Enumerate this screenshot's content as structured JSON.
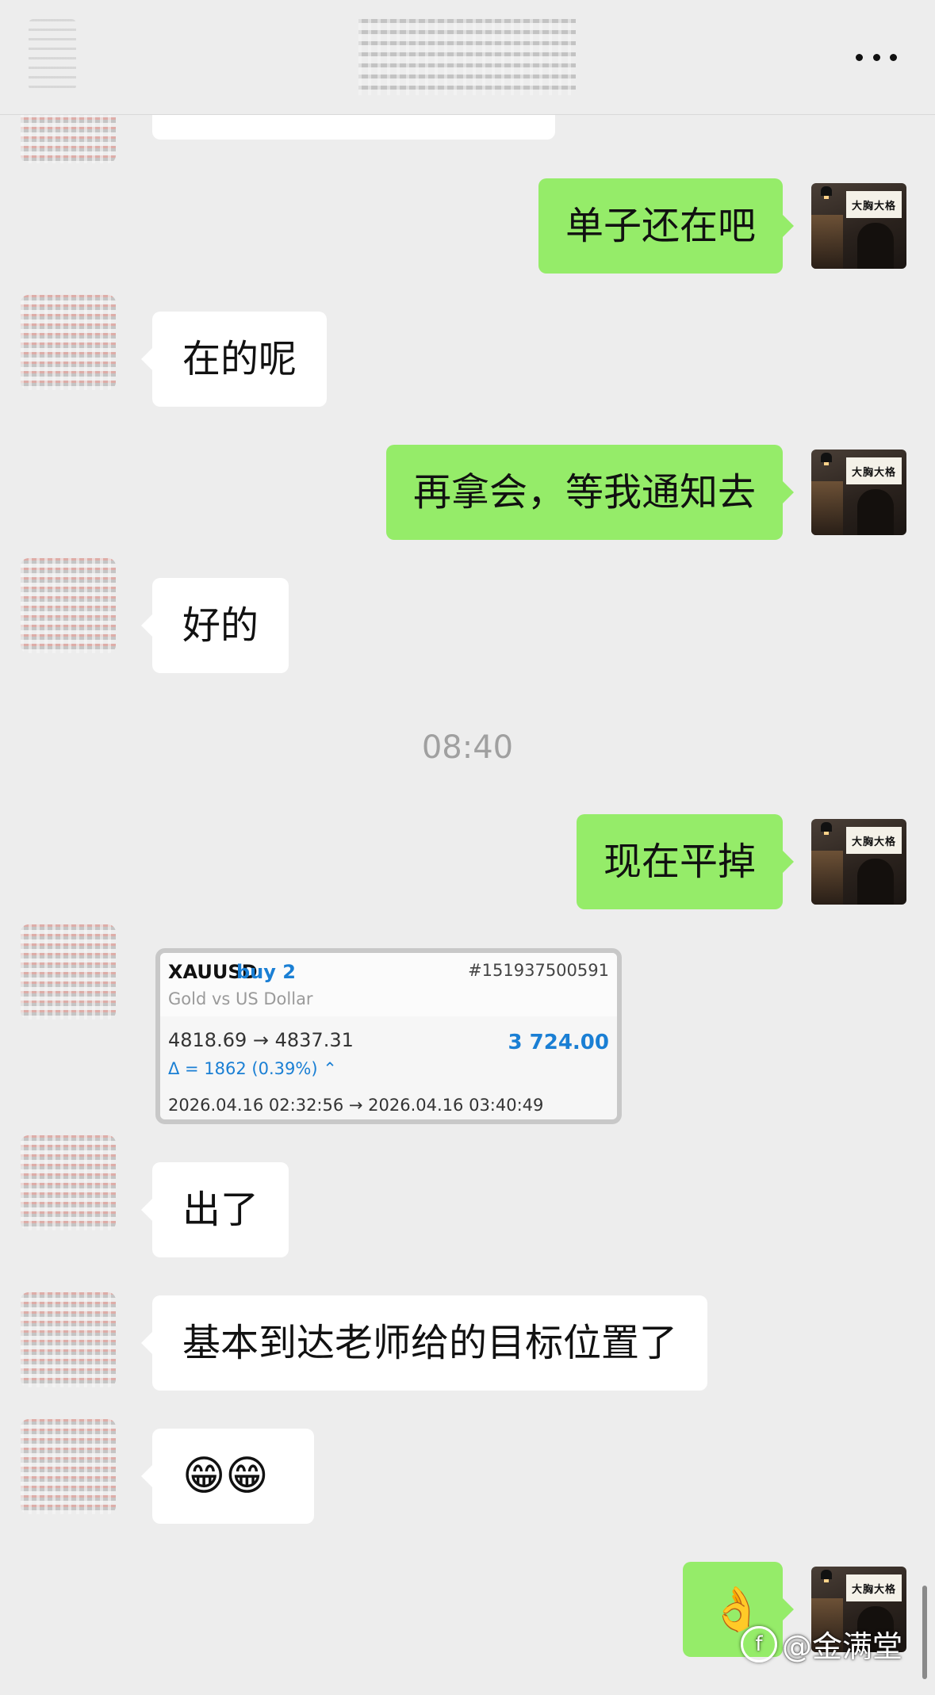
{
  "header": {
    "more_icon": "more-dots-icon"
  },
  "messages": [
    {
      "side": "right",
      "text": "单子还在吧"
    },
    {
      "side": "left",
      "text": "在的呢"
    },
    {
      "side": "right",
      "text": "再拿会，等我通知去"
    },
    {
      "side": "left",
      "text": "好的"
    },
    {
      "side": "right",
      "text": "现在平掉"
    },
    {
      "side": "left",
      "text": "出了"
    },
    {
      "side": "left",
      "text": "基本到达老师给的目标位置了"
    },
    {
      "side": "left",
      "text": "😁😁"
    },
    {
      "side": "right",
      "text": "👌"
    }
  ],
  "timestamp": "08:40",
  "trade_card": {
    "symbol": "XAUUSD",
    "side": "buy 2",
    "ticket": "#151937500591",
    "description": "Gold vs US Dollar",
    "prices": "4818.69 → 4837.31",
    "profit": "3 724.00",
    "delta": "Δ = 1862 (0.39%) ⌃",
    "times": "2026.04.16 02:32:56 → 2026.04.16 03:40:49",
    "profit_color": "#1a7fd4"
  },
  "my_avatar": {
    "sign_text": "大胸大格"
  },
  "colors": {
    "background": "#ededed",
    "my_bubble": "#95ec69",
    "their_bubble": "#ffffff"
  },
  "watermark": {
    "logo": "f",
    "text": "@金满堂"
  }
}
